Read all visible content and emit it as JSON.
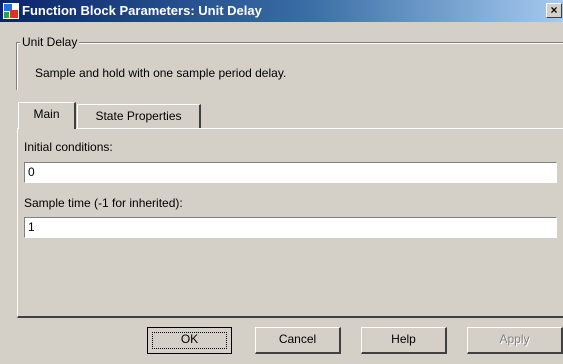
{
  "window": {
    "title": "Function Block Parameters: Unit Delay",
    "close_glyph": "×",
    "icon": "simulink-block-icon",
    "accent_color": "#0a246a"
  },
  "block": {
    "group_label": "Unit Delay",
    "description": "Sample and hold with one sample period delay."
  },
  "tabs": [
    {
      "label": "Main",
      "selected": true
    },
    {
      "label": "State Properties",
      "selected": false
    }
  ],
  "main": {
    "initial_conditions_label": "Initial conditions:",
    "initial_conditions_value": "0",
    "sample_time_label": "Sample time (-1 for inherited):",
    "sample_time_value": "1"
  },
  "buttons": {
    "ok": "OK",
    "cancel": "Cancel",
    "help": "Help",
    "apply": "Apply"
  }
}
